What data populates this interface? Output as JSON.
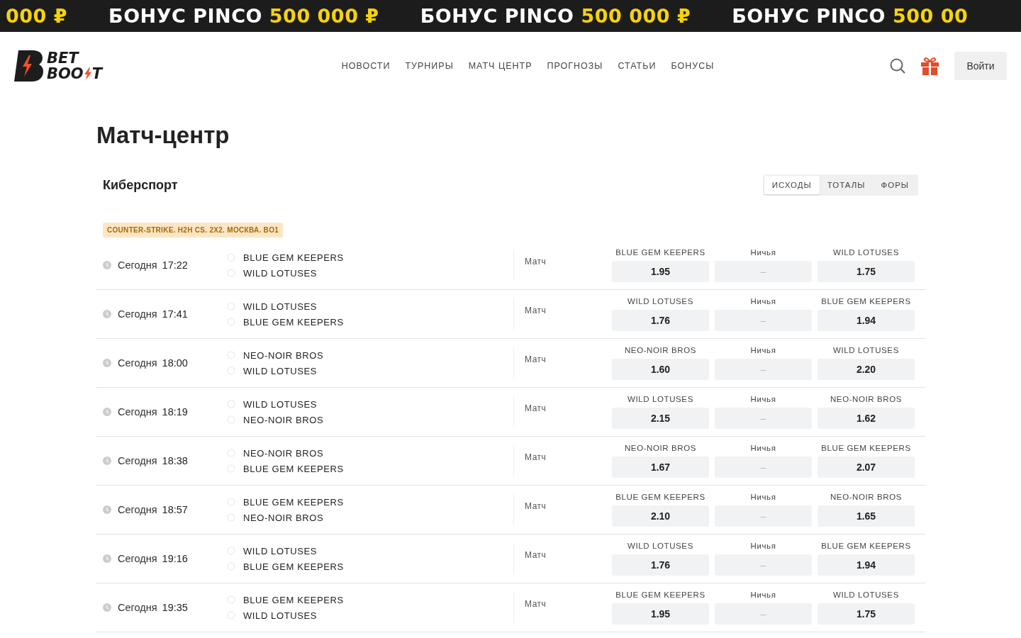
{
  "promo_banner": [
    {
      "amount": "000 ₽"
    },
    {
      "title": "БОНУС PINCO",
      "amount": "500 000 ₽"
    },
    {
      "title": "БОНУС PINCO",
      "amount": "500 000 ₽"
    },
    {
      "title": "БОНУС PINCO",
      "amount": "500 00"
    }
  ],
  "logo": {
    "top": "BET",
    "bottom_start": "BOO",
    "bottom_end": "T"
  },
  "nav": [
    "НОВОСТИ",
    "ТУРНИРЫ",
    "МАТЧ ЦЕНТР",
    "ПРОГНОЗЫ",
    "СТАТЬИ",
    "БОНУСЫ"
  ],
  "login_button": "Войти",
  "page_title": "Матч-центр",
  "section_title": "Киберспорт",
  "market_tabs": [
    {
      "label": "ИСХОДЫ",
      "selected": true
    },
    {
      "label": "ТОТАЛЫ",
      "selected": false
    },
    {
      "label": "ФОРЫ",
      "selected": false
    }
  ],
  "tournament": "COUNTER-STRIKE. H2H CS. 2X2. МОСКВА. BO1",
  "matches": [
    {
      "day": "Сегодня",
      "time": "17:22",
      "teams": [
        "BLUE GEM KEEPERS",
        "WILD LOTUSES"
      ],
      "market": "Матч",
      "odds": [
        {
          "label": "BLUE GEM KEEPERS",
          "value": "1.95"
        },
        {
          "label": "Ничья",
          "value": "–"
        },
        {
          "label": "WILD LOTUSES",
          "value": "1.75"
        }
      ]
    },
    {
      "day": "Сегодня",
      "time": "17:41",
      "teams": [
        "WILD LOTUSES",
        "BLUE GEM KEEPERS"
      ],
      "market": "Матч",
      "odds": [
        {
          "label": "WILD LOTUSES",
          "value": "1.76"
        },
        {
          "label": "Ничья",
          "value": "–"
        },
        {
          "label": "BLUE GEM KEEPERS",
          "value": "1.94"
        }
      ]
    },
    {
      "day": "Сегодня",
      "time": "18:00",
      "teams": [
        "NEO-NOIR BROS",
        "WILD LOTUSES"
      ],
      "market": "Матч",
      "odds": [
        {
          "label": "NEO-NOIR BROS",
          "value": "1.60"
        },
        {
          "label": "Ничья",
          "value": "–"
        },
        {
          "label": "WILD LOTUSES",
          "value": "2.20"
        }
      ]
    },
    {
      "day": "Сегодня",
      "time": "18:19",
      "teams": [
        "WILD LOTUSES",
        "NEO-NOIR BROS"
      ],
      "market": "Матч",
      "odds": [
        {
          "label": "WILD LOTUSES",
          "value": "2.15"
        },
        {
          "label": "Ничья",
          "value": "–"
        },
        {
          "label": "NEO-NOIR BROS",
          "value": "1.62"
        }
      ]
    },
    {
      "day": "Сегодня",
      "time": "18:38",
      "teams": [
        "NEO-NOIR BROS",
        "BLUE GEM KEEPERS"
      ],
      "market": "Матч",
      "odds": [
        {
          "label": "NEO-NOIR BROS",
          "value": "1.67"
        },
        {
          "label": "Ничья",
          "value": "–"
        },
        {
          "label": "BLUE GEM KEEPERS",
          "value": "2.07"
        }
      ]
    },
    {
      "day": "Сегодня",
      "time": "18:57",
      "teams": [
        "BLUE GEM KEEPERS",
        "NEO-NOIR BROS"
      ],
      "market": "Матч",
      "odds": [
        {
          "label": "BLUE GEM KEEPERS",
          "value": "2.10"
        },
        {
          "label": "Ничья",
          "value": "–"
        },
        {
          "label": "NEO-NOIR BROS",
          "value": "1.65"
        }
      ]
    },
    {
      "day": "Сегодня",
      "time": "19:16",
      "teams": [
        "WILD LOTUSES",
        "BLUE GEM KEEPERS"
      ],
      "market": "Матч",
      "odds": [
        {
          "label": "WILD LOTUSES",
          "value": "1.76"
        },
        {
          "label": "Ничья",
          "value": "–"
        },
        {
          "label": "BLUE GEM KEEPERS",
          "value": "1.94"
        }
      ]
    },
    {
      "day": "Сегодня",
      "time": "19:35",
      "teams": [
        "BLUE GEM KEEPERS",
        "WILD LOTUSES"
      ],
      "market": "Матч",
      "odds": [
        {
          "label": "BLUE GEM KEEPERS",
          "value": "1.95"
        },
        {
          "label": "Ничья",
          "value": "–"
        },
        {
          "label": "WILD LOTUSES",
          "value": "1.75"
        }
      ]
    }
  ]
}
